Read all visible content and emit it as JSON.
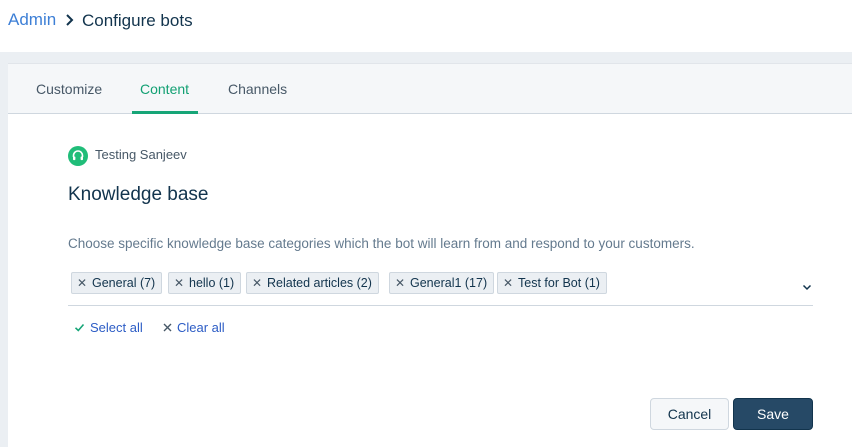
{
  "breadcrumb": {
    "parent": "Admin",
    "current": "Configure bots"
  },
  "tabs": [
    {
      "label": "Customize",
      "active": false
    },
    {
      "label": "Content",
      "active": true
    },
    {
      "label": "Channels",
      "active": false
    }
  ],
  "bot": {
    "name": "Testing Sanjeev",
    "icon": "headset-icon"
  },
  "knowledge_base": {
    "title": "Knowledge base",
    "description": "Choose specific knowledge base categories which the bot will learn from and respond to your customers.",
    "tags": [
      "General (7)",
      "hello (1)",
      "Related articles (2)",
      "General1 (17)",
      "Test for Bot (1)"
    ],
    "select_all": "Select all",
    "clear_all": "Clear all"
  },
  "actions": {
    "cancel": "Cancel",
    "save": "Save"
  },
  "colors": {
    "accent_green": "#16a577",
    "link_blue": "#2c5cc5",
    "primary_button": "#264966"
  }
}
